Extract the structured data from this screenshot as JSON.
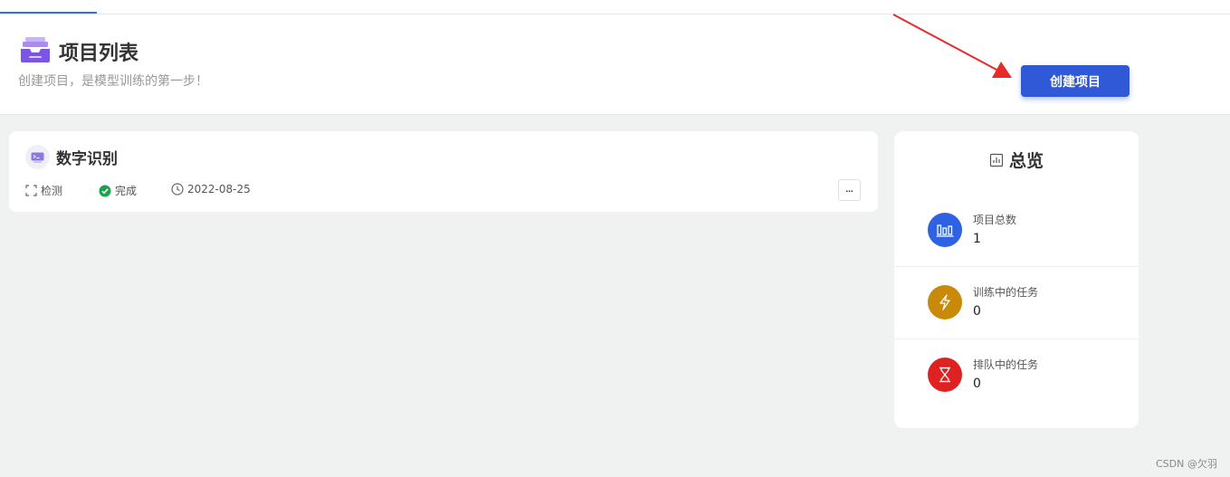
{
  "header": {
    "title": "项目列表",
    "subtitle": "创建项目，是模型训练的第一步！",
    "create_button": "创建项目"
  },
  "projects": [
    {
      "name": "数字识别",
      "type": "检测",
      "status": "完成",
      "date": "2022-08-25",
      "more_label": "..."
    }
  ],
  "overview": {
    "title": "总览",
    "stats": [
      {
        "label": "项目总数",
        "value": "1",
        "color": "#2f62e3",
        "icon": "bar-chart-icon"
      },
      {
        "label": "训练中的任务",
        "value": "0",
        "color": "#c98a0a",
        "icon": "lightning-icon"
      },
      {
        "label": "排队中的任务",
        "value": "0",
        "color": "#de2222",
        "icon": "hourglass-icon"
      }
    ]
  },
  "watermark": "CSDN @欠羽",
  "colors": {
    "accent": "#2f59d6",
    "status_done": "#1aa34a",
    "annotation_arrow": "#e62b2b"
  }
}
